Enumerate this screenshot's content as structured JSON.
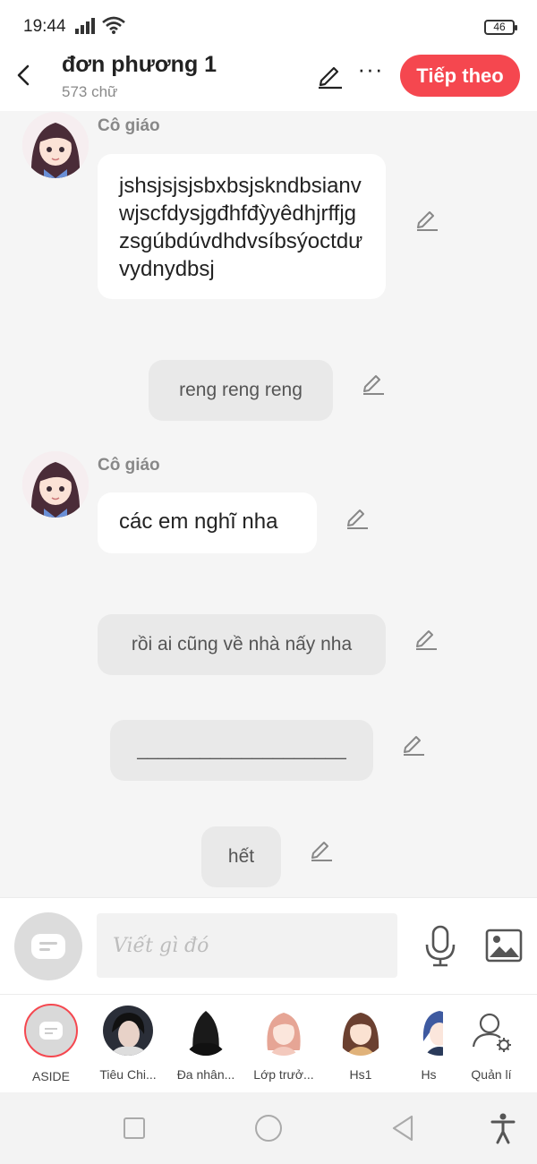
{
  "status_bar": {
    "time": "19:44",
    "battery": "46"
  },
  "header": {
    "title": "đơn phương 1",
    "word_count": "573 chữ",
    "next_label": "Tiếp theo",
    "more_label": "···"
  },
  "messages": [
    {
      "type": "character",
      "sender": "Cô giáo",
      "text": "jshsjsjsjsbxbsjskndbsianvwjscfdysjgđhfđỳyêdhjrffjgzsgúbdúvdhdvsíbsýoctdưvydnydbsj"
    },
    {
      "type": "narration",
      "text": "reng reng reng"
    },
    {
      "type": "character",
      "sender": "Cô giáo",
      "text": "các em nghĩ nha"
    },
    {
      "type": "narration",
      "text": "rồi ai cũng về nhà nấy nha"
    },
    {
      "type": "narration",
      "text": "____________________"
    },
    {
      "type": "narration",
      "text": "hết"
    }
  ],
  "input": {
    "placeholder": "Viết gì đó"
  },
  "characters": [
    {
      "name": "ASIDE"
    },
    {
      "name": "Tiêu Chi..."
    },
    {
      "name": "Đa nhân..."
    },
    {
      "name": "Lớp trưở..."
    },
    {
      "name": "Hs1"
    },
    {
      "name": "Hs"
    },
    {
      "name": "Quản lí"
    }
  ],
  "colors": {
    "accent": "#f5474f",
    "chat_bg": "#f5f5f5",
    "bubble_white": "#ffffff",
    "bubble_narration": "#e9e9e9"
  }
}
